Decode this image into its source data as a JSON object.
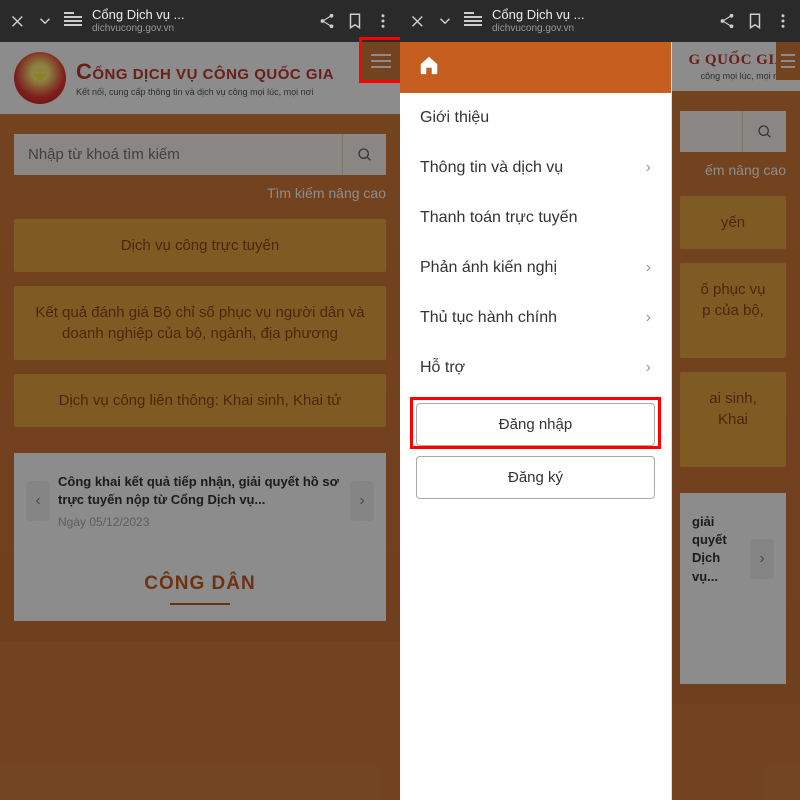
{
  "browser": {
    "title": "Cổng Dịch vụ ...",
    "url": "dichvucong.gov.vn"
  },
  "header": {
    "brand_line1_prefix": "C",
    "brand_line1_rest": "ỔNG DỊCH VỤ CÔNG QUỐC GIA",
    "brand_line2": "Kết nối, cung cấp thông tin và dịch vụ công mọi lúc, mọi nơi"
  },
  "search": {
    "placeholder": "Nhập từ khoá tìm kiếm",
    "advanced": "Tìm kiếm nâng cao"
  },
  "ctas": [
    "Dịch vụ công trực tuyến",
    "Kết quả đánh giá Bộ chỉ số phục vụ người dân và doanh nghiệp của bộ, ngành, địa phương",
    "Dịch vụ công liên thông: Khai sinh, Khai tử"
  ],
  "news": {
    "title": "Công khai kết quả tiếp nhận, giải quyết hồ sơ trực tuyến nộp từ Cổng Dịch vụ...",
    "date": "Ngày 05/12/2023"
  },
  "section_title": "CÔNG DÂN",
  "drawer": {
    "items": [
      {
        "label": "Giới thiệu",
        "has_sub": false
      },
      {
        "label": "Thông tin và dịch vụ",
        "has_sub": true
      },
      {
        "label": "Thanh toán trực tuyến",
        "has_sub": false
      },
      {
        "label": "Phản ánh kiến nghị",
        "has_sub": true
      },
      {
        "label": "Thủ tục hành chính",
        "has_sub": true
      },
      {
        "label": "Hỗ trợ",
        "has_sub": true
      }
    ],
    "login": "Đăng nhập",
    "register": "Đăng ký"
  },
  "right_panel_visible": {
    "brand_suffix": "G QUỐC GIA",
    "tagline_suffix": "công mọi lúc, mọi nơi",
    "adv_search_suffix": "ếm nâng cao",
    "cta1_suffix": "yến",
    "cta2_line1": "ố phục vụ",
    "cta2_line2": "p của bộ,",
    "cta3_suffix": "ai sinh, Khai",
    "news_line1": "giải quyết",
    "news_line2": "Dịch vụ..."
  }
}
